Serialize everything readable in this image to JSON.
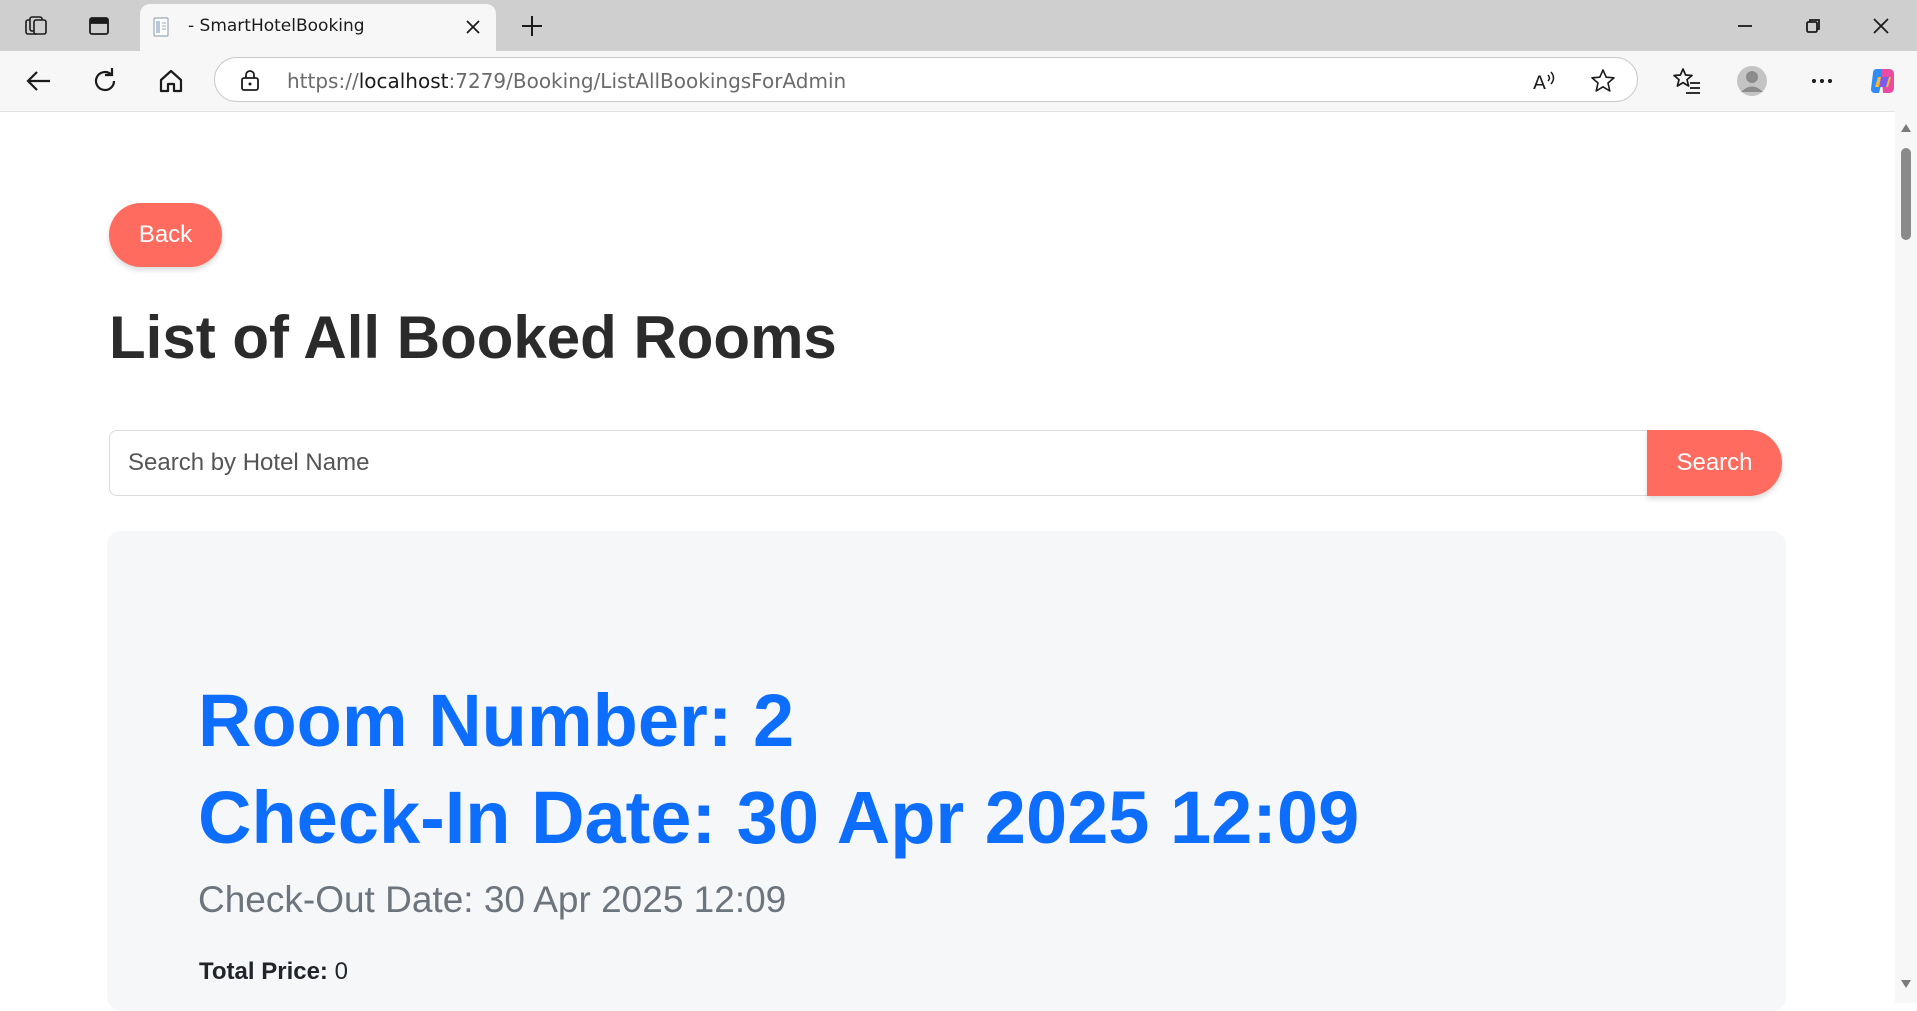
{
  "browser": {
    "tab_title": "- SmartHotelBooking",
    "url_scheme": "https://",
    "url_host": "localhost",
    "url_path": ":7279/Booking/ListAllBookingsForAdmin",
    "icons": [
      "workspaces-icon",
      "tab-actions-icon",
      "page-favicon",
      "close-tab-icon",
      "new-tab-icon",
      "minimize-icon",
      "restore-icon",
      "close-window-icon",
      "back-arrow-icon",
      "refresh-icon",
      "home-icon",
      "lock-icon",
      "read-aloud-icon",
      "favorite-star-icon",
      "favorites-list-icon",
      "profile-avatar-icon",
      "more-options-icon",
      "copilot-icon"
    ]
  },
  "page": {
    "back_label": "Back",
    "title": "List of All Booked Rooms",
    "search": {
      "placeholder": "Search by Hotel Name",
      "value": "",
      "button_label": "Search"
    },
    "booking": {
      "room_number_text": "Room Number: 2",
      "check_in_text": "Check-In Date: 30 Apr 2025 12:09",
      "check_out_text": "Check-Out Date: 30 Apr 2025 12:09",
      "total_price_label": "Total Price:",
      "total_price_value": "0"
    }
  },
  "colors": {
    "accent_coral": "#ff6b5e",
    "heading_blue": "#0d6efd",
    "muted_text": "#6c757d",
    "card_bg": "#f6f7f9"
  }
}
